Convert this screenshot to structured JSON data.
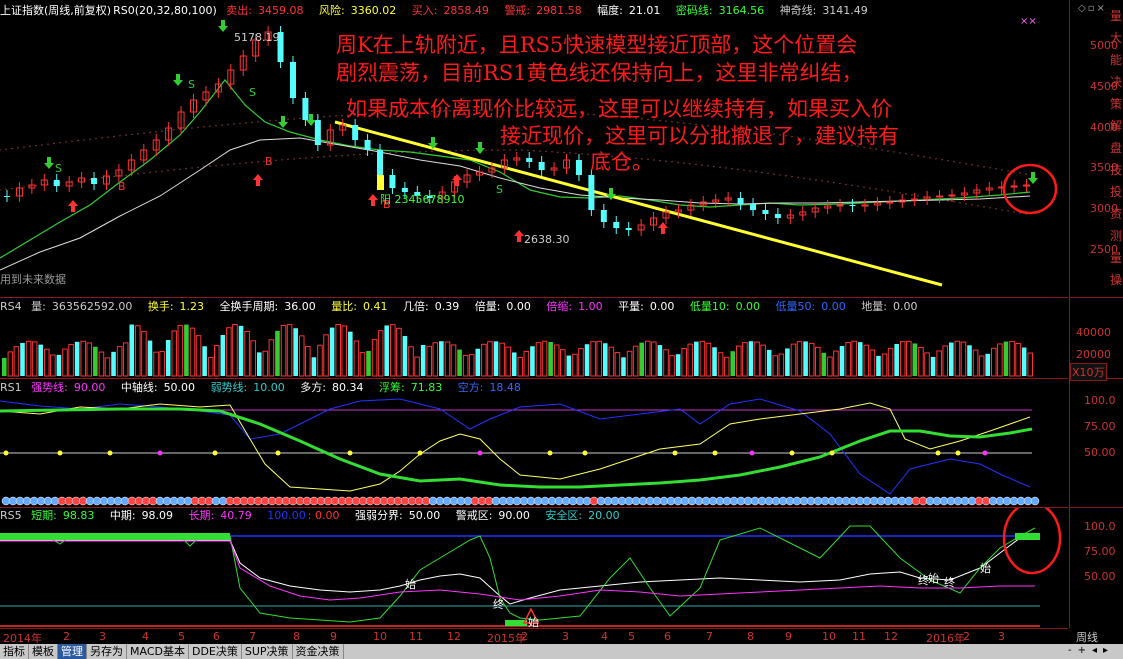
{
  "main_pane": {
    "index_title": "上证指数(周线,前复权)",
    "indicator": "RS0(20,32,80,100)",
    "sell_label": "卖出:",
    "sell_value": "3459.08",
    "risk_label": "风险:",
    "risk_value": "3360.02",
    "buy_label": "买入:",
    "buy_value": "2858.49",
    "alert_label": "警戒:",
    "alert_value": "2981.58",
    "amp_label": "幅度:",
    "amp_value": "21.01",
    "secret_label": "密码线:",
    "secret_value": "3164.56",
    "magic_label": "神奇线:",
    "magic_value": "3141.49",
    "high_label": "5178.19",
    "low_label": "2638.30",
    "count_label": "阳 2345678910",
    "future_note": "用到未来数据",
    "y_ticks": [
      "5000",
      "4500",
      "4000",
      "3500",
      "3000",
      "2500"
    ],
    "annotation_lines": [
      "周K在上轨附近，且RS5快速模型接近顶部，这个位置会",
      "剧烈震荡，目前RS1黄色线还保持向上，这里非常纠结，",
      "如果成本价离现价比较远，这里可以继续持有，如果买入价",
      "接近现价，这里可以分批撤退了，建议持有",
      "底仓。"
    ]
  },
  "rs4": {
    "name": "RS4",
    "vol_label": "量:",
    "vol_value": "363562592.00",
    "turn_label": "换手:",
    "turn_value": "1.23",
    "full_turn_label": "全换手周期:",
    "full_turn_value": "36.00",
    "ratio_label": "量比:",
    "ratio_value": "0.41",
    "times_label": "几倍:",
    "times_value": "0.39",
    "double_label": "倍量:",
    "double_value": "0.00",
    "shrink_label": "倍缩:",
    "shrink_value": "1.00",
    "flat_label": "平量:",
    "flat_value": "0.00",
    "low10_label": "低量10:",
    "low10_value": "0.00",
    "low50_label": "低量50:",
    "low50_value": "0.00",
    "ground_label": "地量:",
    "ground_value": "0.00",
    "y_ticks": [
      "40000",
      "20000"
    ],
    "unit": "X10万"
  },
  "rs1": {
    "name": "RS1",
    "strong_label": "强势线:",
    "strong_value": "90.00",
    "mid_label": "中轴线:",
    "mid_value": "50.00",
    "weak_label": "弱势线:",
    "weak_value": "10.00",
    "long_label": "多方:",
    "long_value": "80.34",
    "float_label": "浮筹:",
    "float_value": "71.83",
    "short_label": "空方:",
    "short_value": "18.48",
    "y_ticks": [
      "100.0",
      "75.00",
      "50.00"
    ]
  },
  "rs5": {
    "name": "RS5",
    "short_label": "短期:",
    "short_value": "98.83",
    "mid_label": "中期:",
    "mid_value": "98.09",
    "long_label": "长期:",
    "long_value": "40.79",
    "blue_value": "100.00",
    "red_value": "0.00",
    "bound_label": "强弱分界:",
    "bound_value": "50.00",
    "alert_label": "警戒区:",
    "alert_value": "90.00",
    "safe_label": "安全区:",
    "safe_value": "20.00",
    "y_ticks": [
      "100.0",
      "75.00",
      "50.00"
    ],
    "marks": [
      "始",
      "终",
      "始",
      "终",
      "始",
      "终",
      "始"
    ]
  },
  "time_axis": {
    "labels": [
      "2014年",
      "2",
      "3",
      "4",
      "5",
      "6",
      "7",
      "8",
      "9",
      "10",
      "11",
      "12",
      "2015年",
      "2",
      "3",
      "4",
      "5",
      "6",
      "7",
      "8",
      "9",
      "10",
      "11",
      "12",
      "2016年",
      "2",
      "3"
    ],
    "period": "周线"
  },
  "bottom_tabs": [
    "指标",
    "模板",
    "管理",
    "另存为",
    "MACD基本",
    "DDE决策",
    "SUP决策",
    "资金决策"
  ],
  "side_chars": [
    "量",
    "大",
    "能",
    "决",
    "策",
    "解",
    "盘",
    "技",
    "投",
    "资",
    "测",
    "量",
    "操"
  ],
  "colors": {
    "up": "#ff3333",
    "down": "#54ffff",
    "ma_green": "#33cc33",
    "trendline": "#ffff33",
    "grid_red": "#8b1a1a"
  }
}
